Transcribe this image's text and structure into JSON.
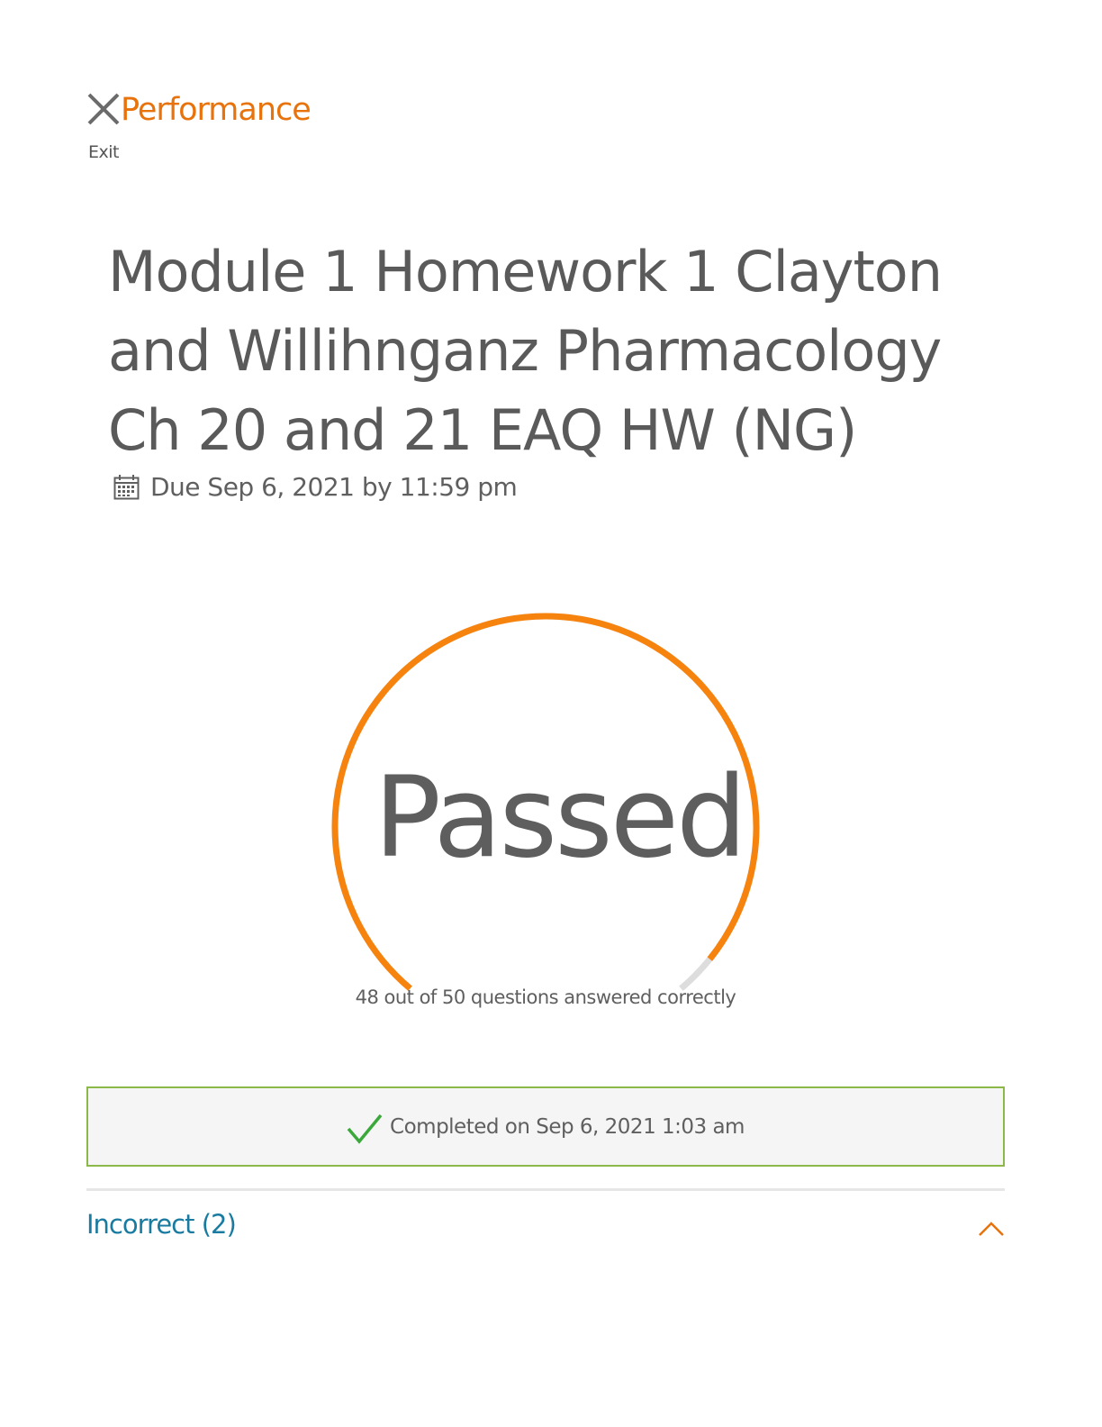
{
  "header": {
    "app_title": "Performance",
    "exit_label": "Exit",
    "close_icon": "close-icon"
  },
  "assignment": {
    "title": "Module 1 Homework 1 Clayton and Willihnganz Pharmacology Ch 20 and 21 EAQ HW (NG)",
    "due": "Due Sep 6, 2021 by 11:59 pm",
    "calendar_icon": "calendar-icon"
  },
  "result": {
    "status": "Passed",
    "correct": 48,
    "total": 50,
    "score_text": "48 out of 50 questions answered correctly",
    "fraction_correct": 0.96
  },
  "completion": {
    "text": "Completed on Sep 6, 2021 1:03 am",
    "icon": "check-icon"
  },
  "sections": [
    {
      "label": "Incorrect (2)",
      "expanded": true,
      "icon": "chevron-up-icon"
    }
  ],
  "colors": {
    "accent": "#f7830f",
    "track": "#dddddd",
    "link": "#1a7ba1",
    "success_border": "#8cb84a",
    "check": "#3aa83a"
  }
}
